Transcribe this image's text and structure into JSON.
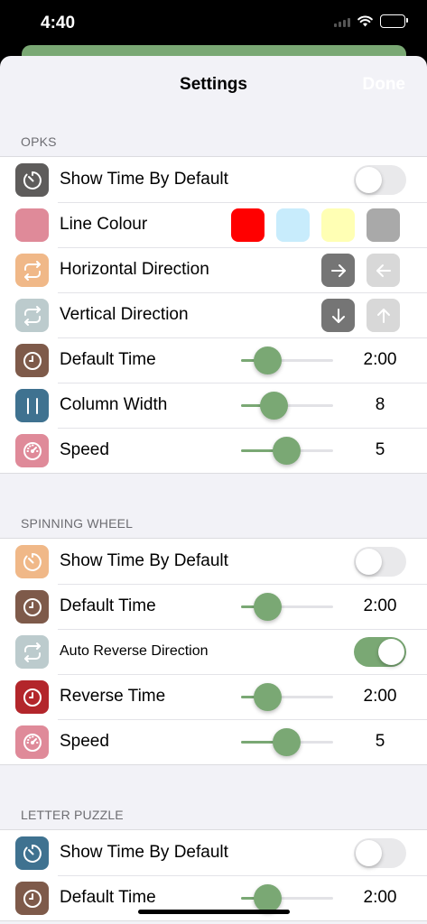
{
  "status_bar": {
    "time": "4:40"
  },
  "nav": {
    "title": "Settings",
    "done_label": "Done"
  },
  "colors": {
    "accent_green": "#7aa874",
    "swatch_red": "#ff0000",
    "swatch_blue": "#c8ecfc",
    "swatch_yellow": "#ffffb4",
    "swatch_gray": "#a9a9a9"
  },
  "sections": [
    {
      "header": "OPKS",
      "rows": [
        {
          "type": "toggle",
          "label": "Show Time By Default",
          "icon": "timer-icon",
          "icon_color": "#5e5c5b",
          "on": false
        },
        {
          "type": "colors",
          "label": "Line Colour",
          "icon": "color-swatch-icon",
          "icon_color": "#df8a99"
        },
        {
          "type": "direction",
          "label": "Horizontal Direction",
          "icon": "repeat-icon",
          "icon_color": "#f0b888",
          "options": [
            "right-arrow-icon",
            "left-arrow-icon"
          ]
        },
        {
          "type": "direction",
          "label": "Vertical Direction",
          "icon": "repeat-icon",
          "icon_color": "#bccbcd",
          "options": [
            "down-arrow-icon",
            "up-arrow-icon"
          ]
        },
        {
          "type": "slider",
          "label": "Default Time",
          "icon": "clock-icon",
          "icon_color": "#7e5a4a",
          "value": "2:00",
          "level": 0.28
        },
        {
          "type": "slider",
          "label": "Column Width",
          "icon": "columns-icon",
          "icon_color": "#3f7290",
          "value": "8",
          "level": 0.35
        },
        {
          "type": "slider",
          "label": "Speed",
          "icon": "speedometer-icon",
          "icon_color": "#df8a99",
          "value": "5",
          "level": 0.49
        }
      ]
    },
    {
      "header": "SPINNING WHEEL",
      "rows": [
        {
          "type": "toggle",
          "label": "Show Time By Default",
          "icon": "timer-icon",
          "icon_color": "#f0b888",
          "on": false
        },
        {
          "type": "slider",
          "label": "Default Time",
          "icon": "clock-icon",
          "icon_color": "#7e5a4a",
          "value": "2:00",
          "level": 0.28
        },
        {
          "type": "toggle",
          "label": "Auto Reverse Direction",
          "icon": "repeat-icon",
          "icon_color": "#bccbcd",
          "on": true
        },
        {
          "type": "slider",
          "label": "Reverse Time",
          "icon": "clock-icon",
          "icon_color": "#b3262b",
          "value": "2:00",
          "level": 0.28
        },
        {
          "type": "slider",
          "label": "Speed",
          "icon": "speedometer-icon",
          "icon_color": "#df8a99",
          "value": "5",
          "level": 0.49
        }
      ]
    },
    {
      "header": "LETTER PUZZLE",
      "rows": [
        {
          "type": "toggle",
          "label": "Show Time By Default",
          "icon": "timer-icon",
          "icon_color": "#3f7290",
          "on": false
        },
        {
          "type": "slider",
          "label": "Default Time",
          "icon": "clock-icon",
          "icon_color": "#7e5a4a",
          "value": "2:00",
          "level": 0.28
        }
      ]
    }
  ]
}
